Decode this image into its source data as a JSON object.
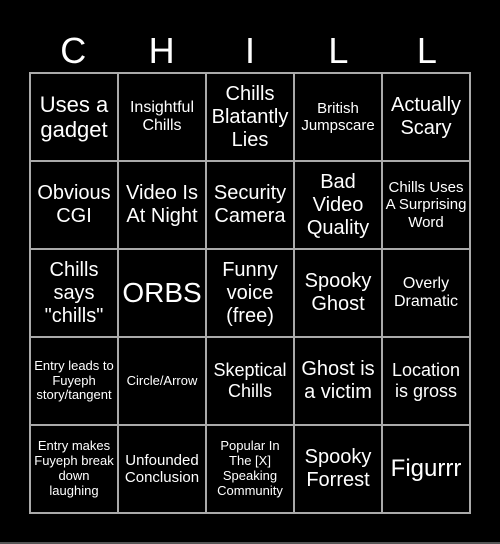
{
  "title_letters": [
    "C",
    "H",
    "I",
    "L",
    "L"
  ],
  "cells": [
    "Uses a gadget",
    "Insightful Chills",
    "Chills Blatantly Lies",
    "British Jumpscare",
    "Actually Scary",
    "Obvious CGI",
    "Video Is At Night",
    "Security Camera",
    "Bad Video Quality",
    "Chills Uses A Surprising Word",
    "Chills says \"chills\"",
    "ORBS",
    "Funny voice (free)",
    "Spooky Ghost",
    "Overly Dramatic",
    "Entry leads to Fuyeph story/tangent",
    "Circle/Arrow",
    "Skeptical Chills",
    "Ghost is a victim",
    "Location is gross",
    "Entry makes Fuyeph break down laughing",
    "Unfounded Conclusion",
    "Popular In The [X] Speaking Community",
    "Spooky Forrest",
    "Figurrr"
  ],
  "colors": {
    "background": "#000000",
    "text": "#ffffff",
    "grid_line": "#aaaaaa"
  }
}
